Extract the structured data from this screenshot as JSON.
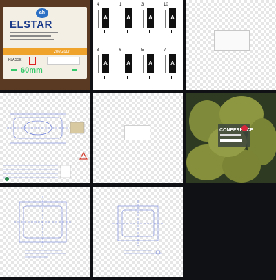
{
  "tiles": [
    {
      "type": "label-photo",
      "logo": "ah",
      "brand": "ELSTAR",
      "band_text": "zoetzuur",
      "class_text": "KLASSE I",
      "measure": "60mm"
    },
    {
      "type": "label-sheet",
      "letter": "A",
      "numbers": [
        "4",
        "1",
        "3",
        "10",
        "8",
        "6",
        "5",
        "7"
      ]
    },
    {
      "type": "blank-checker"
    },
    {
      "type": "technical-drawing"
    },
    {
      "type": "blank-checker-box"
    },
    {
      "type": "pear-photo",
      "title": "CONFERENCE"
    },
    {
      "type": "technical-drawing"
    },
    {
      "type": "technical-drawing"
    },
    {
      "type": "empty"
    }
  ],
  "colors": {
    "background": "#0f1114",
    "accent_green": "#36c96b",
    "band_orange": "#f0a32b",
    "brand_blue": "#1a3a8a",
    "drawing_blue": "#5a6fd8",
    "warning_red": "#d23b2b"
  }
}
